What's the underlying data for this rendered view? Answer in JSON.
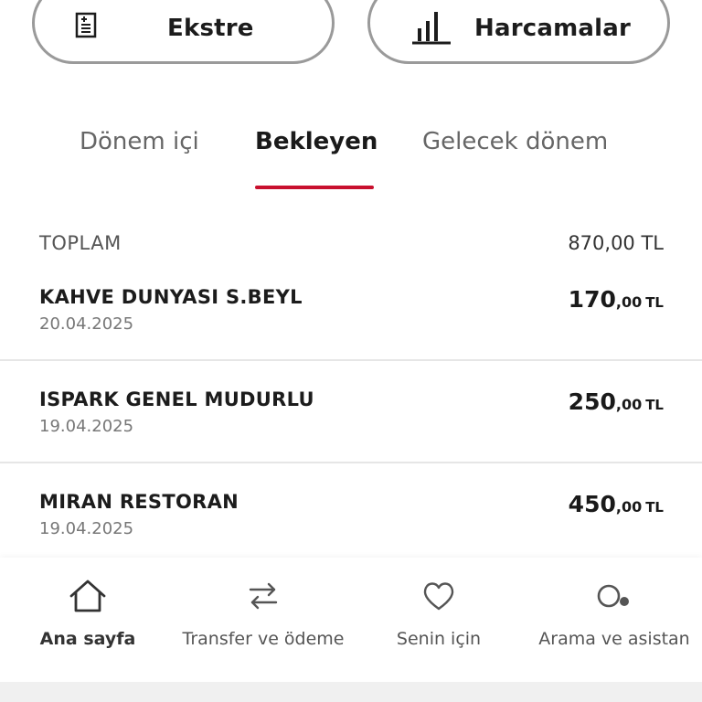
{
  "actions": {
    "statement_label": "Ekstre",
    "spending_label": "Harcamalar",
    "statement_icon": "statement-doc-icon",
    "spending_icon": "bar-chart-icon"
  },
  "tabs": [
    {
      "label": "Dönem içi",
      "active": false
    },
    {
      "label": "Bekleyen",
      "active": true
    },
    {
      "label": "Gelecek dönem",
      "active": false
    }
  ],
  "accent_color": "#c8102e",
  "summary": {
    "total_label": "TOPLAM",
    "total_value": "870,00 TL"
  },
  "transactions": [
    {
      "merchant": "KAHVE DUNYASI S.BEYL",
      "date": "20.04.2025",
      "amount_int": "170",
      "amount_dec": ",00",
      "currency": "TL"
    },
    {
      "merchant": "ISPARK GENEL MUDURLU",
      "date": "19.04.2025",
      "amount_int": "250",
      "amount_dec": ",00",
      "currency": "TL"
    },
    {
      "merchant": "MIRAN RESTORAN",
      "date": "19.04.2025",
      "amount_int": "450",
      "amount_dec": ",00",
      "currency": "TL"
    }
  ],
  "bottom_nav": [
    {
      "label": "Ana sayfa",
      "icon": "home-icon",
      "active": true
    },
    {
      "label": "Transfer ve ödeme",
      "icon": "transfer-arrows-icon",
      "active": false
    },
    {
      "label": "Senin için",
      "icon": "heart-icon",
      "active": false
    },
    {
      "label": "Arama ve asistan",
      "icon": "search-assistant-icon",
      "active": false
    }
  ]
}
